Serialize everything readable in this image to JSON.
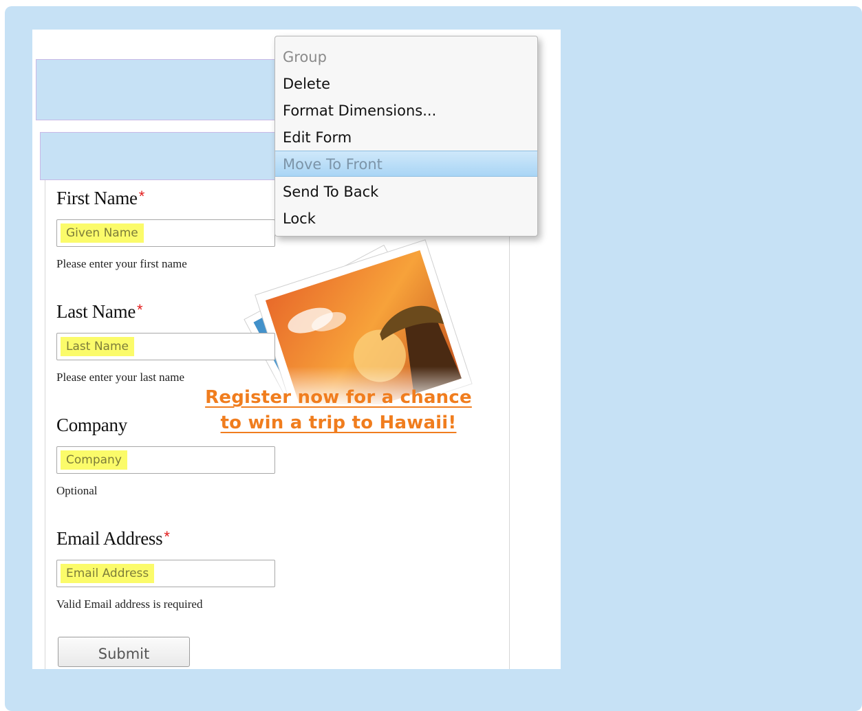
{
  "form": {
    "fields": [
      {
        "label": "First Name",
        "required_mark": "*",
        "placeholder": "Given Name",
        "help": "Please enter your first name"
      },
      {
        "label": "Last Name",
        "required_mark": "*",
        "placeholder": "Last Name",
        "help": "Please enter your last name"
      },
      {
        "label": "Company",
        "required_mark": "",
        "placeholder": "Company",
        "help": "Optional"
      },
      {
        "label": "Email Address",
        "required_mark": "*",
        "placeholder": "Email Address",
        "help": "Valid Email address is required"
      }
    ],
    "submit_label": "Submit"
  },
  "promo": {
    "line1": "Register now for a chance",
    "line2": "to win a trip to Hawaii!"
  },
  "context_menu": {
    "items": [
      {
        "label": "Group",
        "state": "disabled"
      },
      {
        "label": "Delete",
        "state": "normal"
      },
      {
        "label": "Format Dimensions...",
        "state": "normal"
      },
      {
        "label": "Edit Form",
        "state": "normal"
      },
      {
        "label": "Move To Front",
        "state": "highlighted"
      },
      {
        "label": "Send To Back",
        "state": "normal"
      },
      {
        "label": "Lock",
        "state": "normal"
      }
    ]
  },
  "colors": {
    "frame_background": "#c6e1f5",
    "required_mark": "#e21b1b",
    "placeholder_highlight": "#fbfb6a",
    "promo_text": "#f07d1e",
    "menu_highlight": "#a9d5f5"
  },
  "icons": {
    "promo_image": "photo-stack-sunset-icon"
  }
}
